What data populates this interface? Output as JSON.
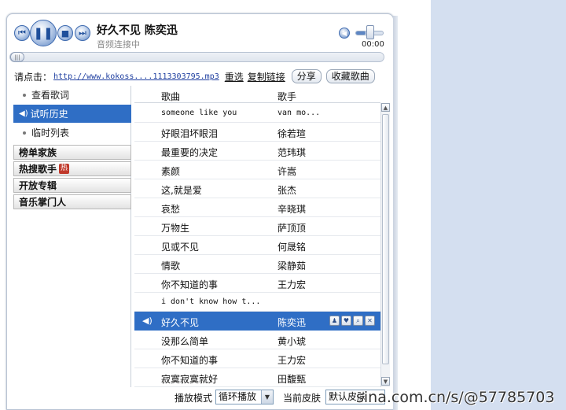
{
  "player": {
    "song_title": "好久不见  陈奕迅",
    "status": "音频连接中",
    "time": "00:00",
    "volume_fraction": 0.35,
    "progress_fraction": 0
  },
  "link_row": {
    "label": "请点击：",
    "url": "http://www.kokoss....1113303795.mp3",
    "select_label": "重选",
    "copy_label": "复制链接",
    "share_label": "分享",
    "favorite_label": "收藏歌曲"
  },
  "sidebar": {
    "items": [
      {
        "label": "查看歌词"
      },
      {
        "label": "试听历史"
      },
      {
        "label": "临时列表"
      }
    ],
    "categories": [
      {
        "label": "榜单家族"
      },
      {
        "label": "热搜歌手",
        "badge": "热"
      },
      {
        "label": "开放专辑"
      },
      {
        "label": "音乐掌门人"
      }
    ]
  },
  "table": {
    "headers": {
      "song": "歌曲",
      "artist": "歌手"
    },
    "rows": [
      {
        "song": "someone like you",
        "artist": "van mo..."
      },
      {
        "song": "好眼泪坏眼泪",
        "artist": "徐若瑄"
      },
      {
        "song": "最重要的决定",
        "artist": "范玮琪"
      },
      {
        "song": "素颜",
        "artist": "许嵩"
      },
      {
        "song": "这,就是爱",
        "artist": "张杰"
      },
      {
        "song": "哀愁",
        "artist": "辛晓琪"
      },
      {
        "song": "万物生",
        "artist": "萨顶顶"
      },
      {
        "song": "见或不见",
        "artist": "何晟铭"
      },
      {
        "song": "情歌",
        "artist": "梁静茹"
      },
      {
        "song": "你不知道的事",
        "artist": "王力宏"
      },
      {
        "song": "i don't know how t...",
        "artist": ""
      },
      {
        "song": "好久不见",
        "artist": "陈奕迅"
      },
      {
        "song": "没那么简单",
        "artist": "黄小琥"
      },
      {
        "song": "你不知道的事",
        "artist": "王力宏"
      },
      {
        "song": "寂寞寂寞就好",
        "artist": "田馥甄"
      }
    ]
  },
  "bottom": {
    "mode_label": "播放模式",
    "mode_value": "循环播放",
    "skin_label": "当前皮肤",
    "skin_value": "默认皮肤"
  },
  "watermark": "sina.com.cn/s/@57785703",
  "colors": {
    "accent": "#2f6ec5",
    "strip": "#d4dff0"
  }
}
